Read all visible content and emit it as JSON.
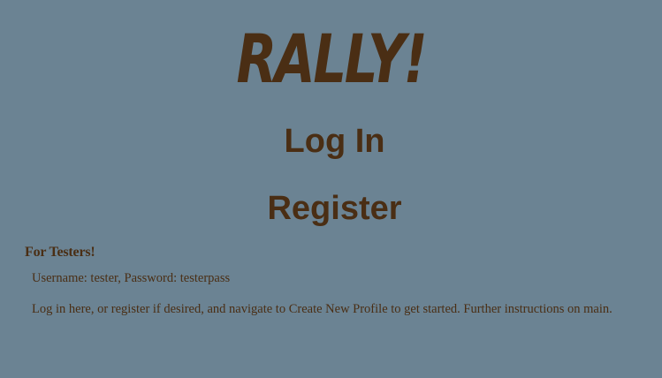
{
  "logo": {
    "text": "RALLY!"
  },
  "nav": {
    "login_label": "Log In",
    "register_label": "Register"
  },
  "testers": {
    "heading": "For Testers!",
    "credentials": "Username: tester, Password: testerpass",
    "instructions": "Log in here, or register if desired, and navigate to Create New Profile to get started. Further instructions on main."
  },
  "colors": {
    "background": "#6b8393",
    "text": "#4a2e14"
  }
}
